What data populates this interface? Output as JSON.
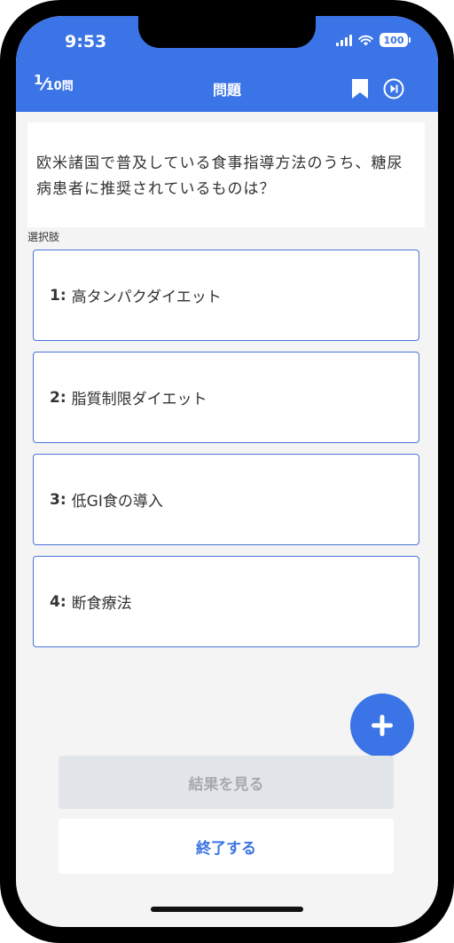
{
  "status_bar": {
    "time": "9:53",
    "battery": "100"
  },
  "nav": {
    "progress_current": "1",
    "progress_sep": "⁄",
    "progress_total": "10問",
    "title": "問題"
  },
  "question": {
    "text": "欧米諸国で普及している食事指導方法のうち、糖尿病患者に推奨されているものは？"
  },
  "choices_label": "選択肢",
  "choices": [
    {
      "num": "1:",
      "text": "高タンパクダイエット"
    },
    {
      "num": "2:",
      "text": "脂質制限ダイエット"
    },
    {
      "num": "3:",
      "text": "低GI食の導入"
    },
    {
      "num": "4:",
      "text": "断食療法"
    }
  ],
  "buttons": {
    "result": "結果を見る",
    "end": "終了する"
  },
  "colors": {
    "accent": "#3b74e6",
    "choice_border": "#4a73d9",
    "disabled_bg": "#e2e5e9",
    "disabled_text": "#a7abb1",
    "background": "#f4f4f4"
  },
  "icons": [
    "bookmark-icon",
    "skip-icon",
    "plus-icon",
    "signal-icon",
    "wifi-icon",
    "battery-icon"
  ]
}
